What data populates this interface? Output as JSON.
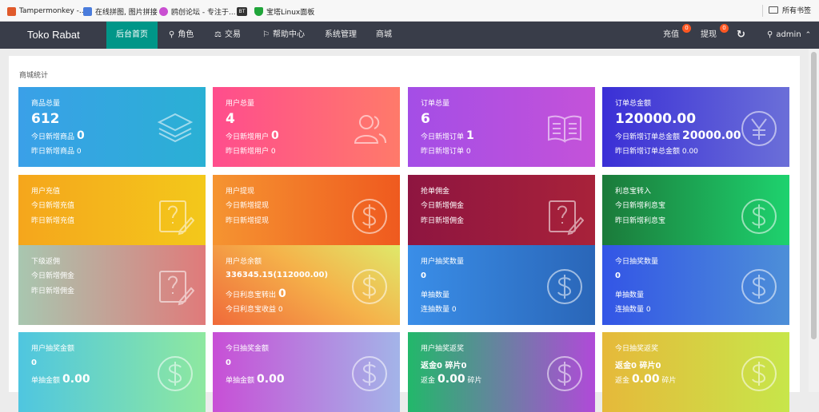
{
  "bookmarks": [
    {
      "label": "Tampermonkey -...",
      "color": "#e05a2b"
    },
    {
      "label": "在线拼图, 图片拼接",
      "color": "#4a7cdc"
    },
    {
      "label": "鸥创论坛 - 专注于...",
      "color": "#c94fd1"
    },
    {
      "label": "BT",
      "color": "#333333"
    },
    {
      "label": "宝塔Linux面板",
      "color": "#20a53a"
    }
  ],
  "all_bookmarks": "所有书签",
  "nav": {
    "brand": "Toko Rabat",
    "items": [
      "后台首页",
      "角色",
      "交易",
      "帮助中心",
      "系统管理",
      "商城"
    ],
    "recharge": "充值",
    "recharge_badge": "0",
    "withdraw": "提现",
    "withdraw_badge": "0",
    "user": "admin"
  },
  "panel_title": "商城统计",
  "cards": [
    {
      "title": "商品总量",
      "big": "612",
      "mid_label": "今日新增商品",
      "mid_value": "0",
      "low": "昨日新增商品 0"
    },
    {
      "title": "用户总量",
      "big": "4",
      "mid_label": "今日新增用户",
      "mid_value": "0",
      "low": "昨日新增用户 0"
    },
    {
      "title": "订单总量",
      "big": "6",
      "mid_label": "今日新增订单",
      "mid_value": "1",
      "low": "昨日新增订单 0"
    },
    {
      "title": "订单总金额",
      "big": "120000.00",
      "mid_label": "今日新增订单总金额",
      "mid_value": "20000.00",
      "low": "昨日新增订单总金额 0.00"
    },
    {
      "title": "用户充值",
      "line1": "今日新增充值",
      "line2": "昨日新增充值"
    },
    {
      "title": "用户提现",
      "line1": "今日新增提现",
      "line2": "昨日新增提现"
    },
    {
      "title": "抢单佣金",
      "line1": "今日新增佣金",
      "line2": "昨日新增佣金"
    },
    {
      "title": "利息宝转入",
      "line1": "今日新增利息宝",
      "line2": "昨日新增利息宝"
    },
    {
      "title": "下级返佣",
      "line1": "今日新增佣金",
      "line2": "昨日新增佣金"
    },
    {
      "title": "用户总余额",
      "amount": "336345.15(112000.00)",
      "mid_label": "今日利息宝转出",
      "mid_value": "0",
      "low": "今日利息宝收益 0"
    },
    {
      "title": "用户抽奖数量",
      "value": "0",
      "line_a": "单抽数量",
      "line_b": "连抽数量 0"
    },
    {
      "title": "今日抽奖数量",
      "value": "0",
      "line_a": "单抽数量",
      "line_b": "连抽数量 0"
    },
    {
      "title": "用户抽奖金额",
      "value": "0",
      "amt_label": "单抽金额",
      "amt_value": "0.00"
    },
    {
      "title": "今日抽奖金额",
      "value": "0",
      "amt_label": "单抽金额",
      "amt_value": "0.00"
    },
    {
      "title": "用户抽奖返奖",
      "value": "返金0 碎片0",
      "amt_label": "返金",
      "amt_value": "0.00",
      "amt_suffix": "碎片"
    },
    {
      "title": "今日抽奖返奖",
      "value": "返金0 碎片0",
      "amt_label": "返金",
      "amt_value": "0.00",
      "amt_suffix": "碎片"
    }
  ],
  "card_icons": [
    "layers-icon",
    "users-icon",
    "book-icon",
    "yen-icon",
    "note-edit-icon",
    "dollar-icon",
    "note-edit-icon",
    "dollar-icon",
    "note-edit-icon",
    "dollar-icon",
    "dollar-icon",
    "dollar-icon",
    "dollar-icon",
    "dollar-icon",
    "dollar-icon",
    "dollar-icon"
  ],
  "colors": {
    "nav_bg": "#393d49",
    "nav_active": "#009688",
    "badge": "#ff5722"
  }
}
